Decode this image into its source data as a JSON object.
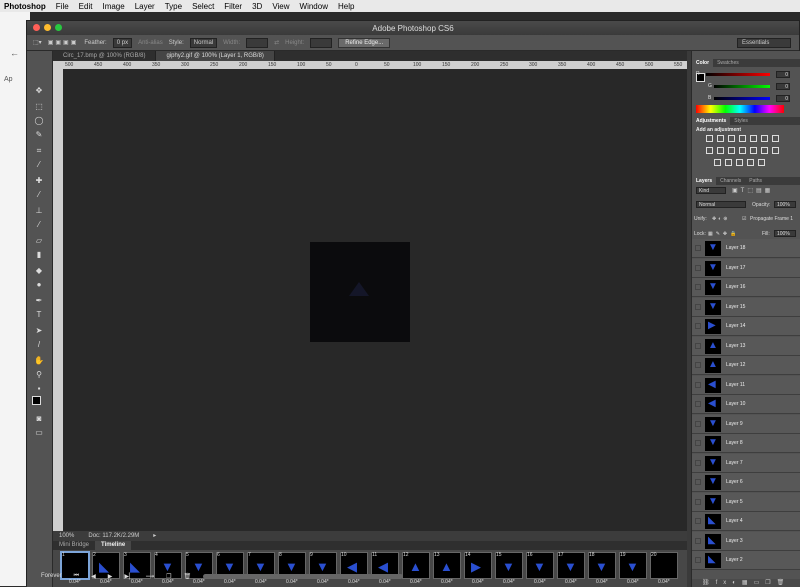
{
  "menubar": {
    "app": "Photoshop",
    "items": [
      "File",
      "Edit",
      "Image",
      "Layer",
      "Type",
      "Select",
      "Filter",
      "3D",
      "View",
      "Window",
      "Help"
    ]
  },
  "background_window": {
    "text1": "←",
    "text2": "Ap"
  },
  "window": {
    "title": "Adobe Photoshop CS6"
  },
  "options": {
    "feather_label": "Feather:",
    "feather_value": "0 px",
    "antialias_label": "Anti-alias",
    "style_label": "Style:",
    "style_value": "Normal",
    "width_label": "Width:",
    "height_label": "Height:",
    "refine_edge": "Refine Edge...",
    "workspace": "Essentials"
  },
  "doc_tabs": [
    {
      "label": "Circ_17.bmp @ 100% (RGB/8)"
    },
    {
      "label": "giphy2.gif @ 100% (Layer 1, RGB/8)"
    }
  ],
  "ruler": {
    "ticks": [
      "500",
      "450",
      "400",
      "350",
      "300",
      "250",
      "200",
      "150",
      "100",
      "50",
      "0",
      "50",
      "100",
      "150",
      "200",
      "250",
      "300",
      "350",
      "400",
      "450",
      "500",
      "550"
    ]
  },
  "status": {
    "zoom": "100%",
    "doc": "Doc: 117.2K/2.29M"
  },
  "timeline": {
    "tabs": [
      "Mini Bridge",
      "Timeline"
    ],
    "loop": "Forever",
    "frames": [
      {
        "num": "1",
        "delay": "0.04*"
      },
      {
        "num": "2",
        "delay": "0.04*"
      },
      {
        "num": "3",
        "delay": "0.04*"
      },
      {
        "num": "4",
        "delay": "0.04*"
      },
      {
        "num": "5",
        "delay": "0.04*"
      },
      {
        "num": "6",
        "delay": "0.04*"
      },
      {
        "num": "7",
        "delay": "0.04*"
      },
      {
        "num": "8",
        "delay": "0.04*"
      },
      {
        "num": "9",
        "delay": "0.04*"
      },
      {
        "num": "10",
        "delay": "0.04*"
      },
      {
        "num": "11",
        "delay": "0.04*"
      },
      {
        "num": "12",
        "delay": "0.04*"
      },
      {
        "num": "13",
        "delay": "0.04*"
      },
      {
        "num": "14",
        "delay": "0.04*"
      },
      {
        "num": "15",
        "delay": "0.04*"
      },
      {
        "num": "16",
        "delay": "0.04*"
      },
      {
        "num": "17",
        "delay": "0.04*"
      },
      {
        "num": "18",
        "delay": "0.04*"
      },
      {
        "num": "19",
        "delay": "0.04*"
      },
      {
        "num": "20",
        "delay": "0.04*"
      }
    ]
  },
  "color_panel": {
    "tabs": [
      "Color",
      "Swatches"
    ],
    "r_label": "R",
    "g_label": "G",
    "b_label": "B",
    "r": "0",
    "g": "0",
    "b": "0"
  },
  "adjustments": {
    "tabs": [
      "Adjustments",
      "Styles"
    ],
    "heading": "Add an adjustment"
  },
  "layers_panel": {
    "tabs": [
      "Layers",
      "Channels",
      "Paths"
    ],
    "kind": "Kind",
    "blend": "Normal",
    "opacity_label": "Opacity:",
    "opacity": "100%",
    "unify_label": "Unify:",
    "propagate": "Propagate Frame 1",
    "lock_label": "Lock:",
    "fill_label": "Fill:",
    "fill": "100%",
    "layers": [
      "Layer 18",
      "Layer 17",
      "Layer 16",
      "Layer 15",
      "Layer 14",
      "Layer 13",
      "Layer 12",
      "Layer 11",
      "Layer 10",
      "Layer 9",
      "Layer 8",
      "Layer 7",
      "Layer 6",
      "Layer 5",
      "Layer 4",
      "Layer 3",
      "Layer 2"
    ]
  },
  "colors": {
    "accent": "#7da5d9",
    "triangle": "#2a4fd0"
  }
}
